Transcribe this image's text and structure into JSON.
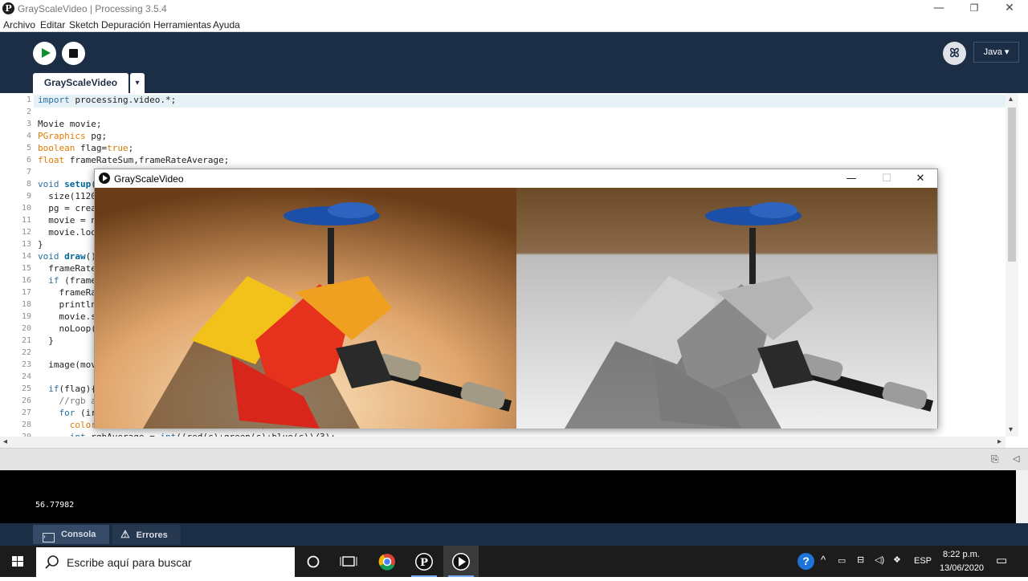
{
  "window": {
    "title": "GrayScaleVideo | Processing 3.5.4",
    "minimize": "—",
    "restore": "❐",
    "close": "✕"
  },
  "menu": [
    "Archivo",
    "Editar",
    "Sketch",
    "Depuración",
    "Herramientas",
    "Ayuda"
  ],
  "toolbar": {
    "run_icon": "play-icon",
    "stop_icon": "stop-icon",
    "debugger_icon": "butterfly-icon",
    "mode": "Java ▾"
  },
  "tab": {
    "name": "GrayScaleVideo",
    "menu_arrow": "▾"
  },
  "editor": {
    "line_numbers": [
      "1",
      "2",
      "3",
      "4",
      "5",
      "6",
      "7",
      "8",
      "9",
      "10",
      "11",
      "12",
      "13",
      "14",
      "15",
      "16",
      "17",
      "18",
      "19",
      "20",
      "21",
      "22",
      "23",
      "24",
      "25",
      "26",
      "27",
      "28",
      "29"
    ],
    "lines": [
      {
        "t": "import processing.video.*;"
      },
      {
        "t": ""
      },
      {
        "t": "Movie movie;"
      },
      {
        "t": "PGraphics pg;"
      },
      {
        "t": "boolean flag=true;"
      },
      {
        "t": "float frameRateSum,frameRateAverage;"
      },
      {
        "t": ""
      },
      {
        "t": "void setup("
      },
      {
        "t": "  size(1120"
      },
      {
        "t": "  pg = crea"
      },
      {
        "t": "  movie = n"
      },
      {
        "t": "  movie.loo"
      },
      {
        "t": "}"
      },
      {
        "t": "void draw()"
      },
      {
        "t": "  frameRate"
      },
      {
        "t": "  if (frame"
      },
      {
        "t": "    frameRa"
      },
      {
        "t": "    println"
      },
      {
        "t": "    movie.s"
      },
      {
        "t": "    noLoop("
      },
      {
        "t": "  }"
      },
      {
        "t": ""
      },
      {
        "t": "  image(mov"
      },
      {
        "t": ""
      },
      {
        "t": "  if(flag){"
      },
      {
        "t": "    //rgb a"
      },
      {
        "t": "    for (ir"
      },
      {
        "t": "      color                               ;"
      },
      {
        "t": "      int rgbAverage = int((red(c)+green(c)+blue(c))/3);"
      }
    ]
  },
  "console": {
    "output": "56.77982",
    "tab_console": "Consola",
    "tab_errors": "Errores"
  },
  "video_window": {
    "title": "GrayScaleVideo",
    "minimize": "—",
    "maximize": "☐",
    "close": "✕"
  },
  "taskbar": {
    "search_placeholder": "Escribe aquí para buscar",
    "language": "ESP",
    "time": "8:22 p.m.",
    "date": "13/06/2020"
  }
}
